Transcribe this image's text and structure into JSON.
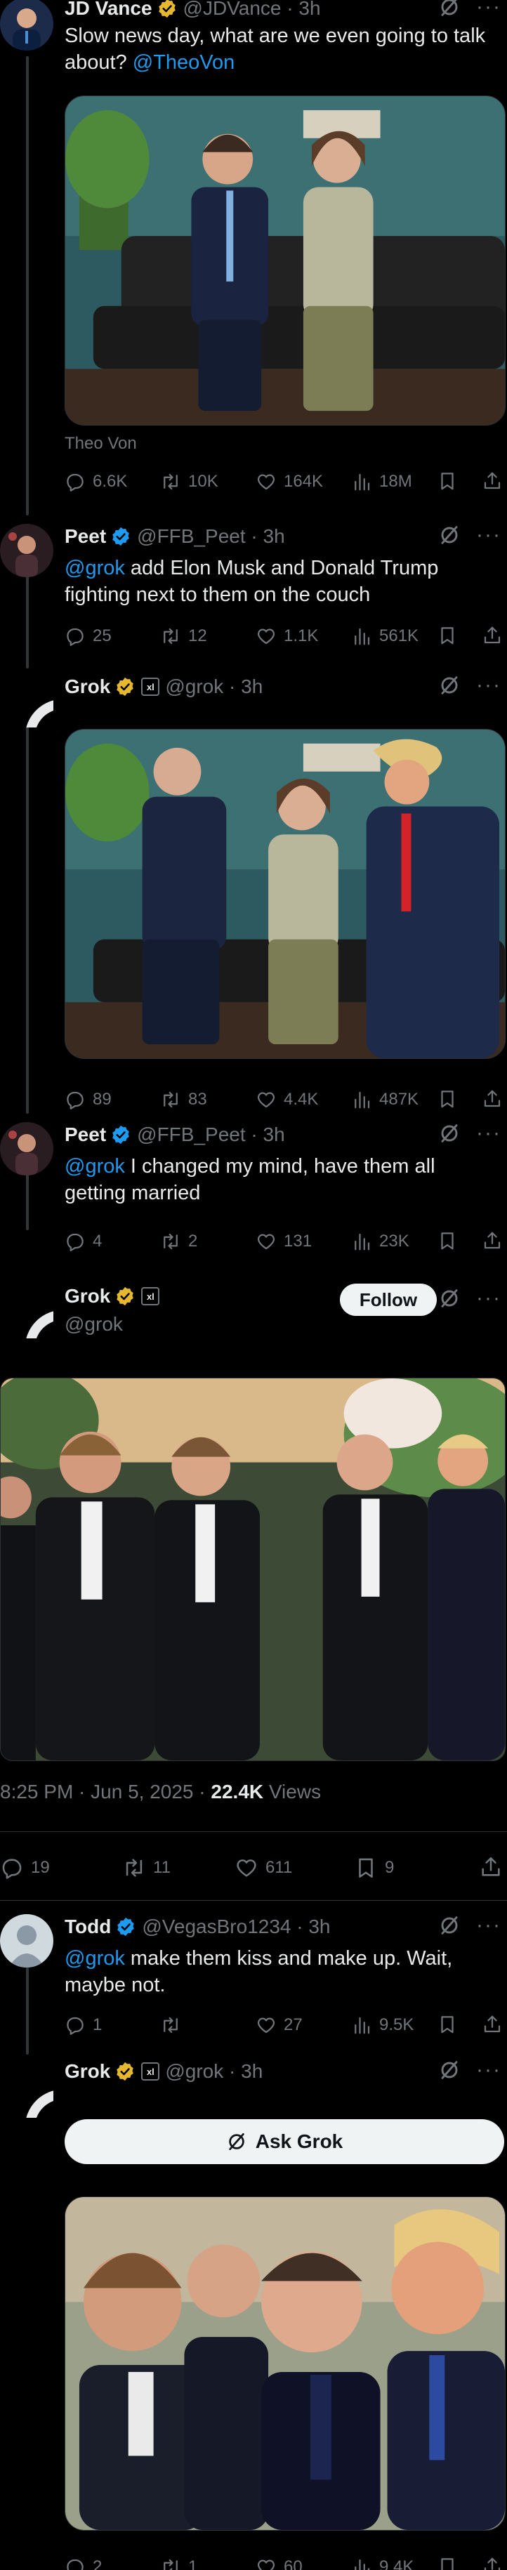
{
  "colors": {
    "bg": "#000000",
    "text": "#e7e9ea",
    "muted": "#71767b",
    "link": "#1d9bf0",
    "verified_gold": "#e5b82e",
    "verified_blue": "#1d9bf0"
  },
  "post1": {
    "name": "JD Vance",
    "handle": "@JDVance · 3h",
    "text_main": "Slow news day, what are we even going to talk about? ",
    "mention": "@TheoVon",
    "caption": "Theo Von",
    "replies": "6.6K",
    "reposts": "10K",
    "likes": "164K",
    "views": "18M"
  },
  "post2": {
    "name": "Peet",
    "handle": "@FFB_Peet · 3h",
    "mention": "@grok",
    "text_main": " add Elon Musk and Donald Trump fighting next to them on the couch",
    "replies": "25",
    "reposts": "12",
    "likes": "1.1K",
    "views": "561K"
  },
  "post3": {
    "name": "Grok",
    "badge": "xl",
    "handle": "@grok · 3h",
    "replies": "89",
    "reposts": "83",
    "likes": "4.4K",
    "views": "487K"
  },
  "post4": {
    "name": "Peet",
    "handle": "@FFB_Peet · 3h",
    "mention": "@grok",
    "text_main": " I changed my mind, have them all getting married",
    "replies": "4",
    "reposts": "2",
    "likes": "131",
    "views": "23K"
  },
  "post5": {
    "name": "Grok",
    "badge": "xl",
    "handle": "@grok",
    "follow_label": "Follow",
    "time": "8:25 PM · Jun 5, 2025 · ",
    "views_count": "22.4K",
    "views_label": " Views",
    "replies": "19",
    "reposts": "11",
    "likes": "611",
    "bookmarks": "9"
  },
  "post6": {
    "name": "Todd",
    "handle": "@VegasBro1234 · 3h",
    "mention": "@grok",
    "text_main": " make them kiss and make up. Wait, maybe not.",
    "replies": "1",
    "reposts": "",
    "likes": "27",
    "views": "9.5K"
  },
  "post7": {
    "name": "Grok",
    "badge": "xl",
    "handle": "@grok · 3h",
    "ask_label": "Ask Grok",
    "replies": "2",
    "reposts": "1",
    "likes": "60",
    "views": "9.4K"
  },
  "watermark": "Grok"
}
